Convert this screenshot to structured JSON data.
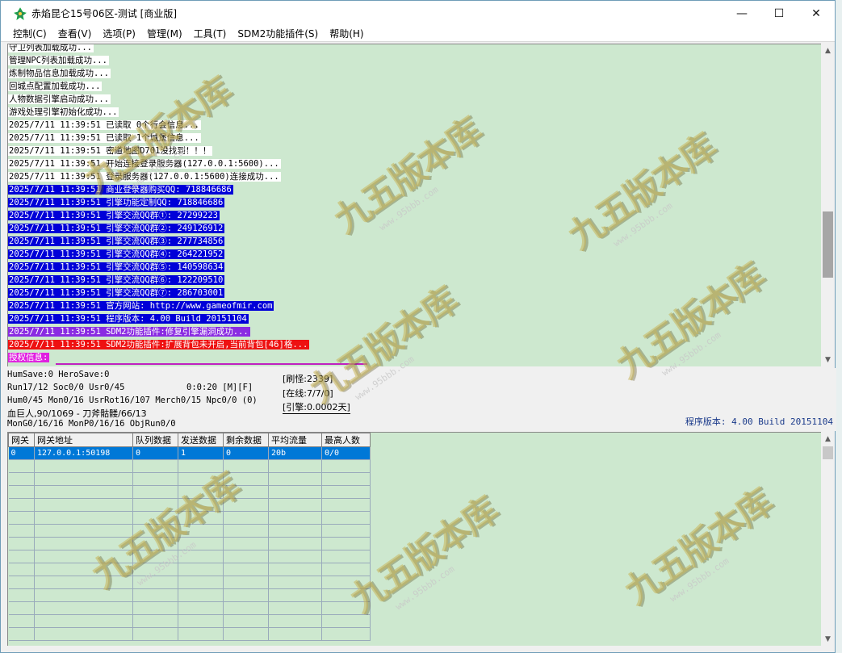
{
  "window": {
    "title": "赤焰昆仑15号06区-测试 [商业版]",
    "minimize": "—",
    "maximize": "☐",
    "close": "✕"
  },
  "menu": [
    "控制(C)",
    "查看(V)",
    "选项(P)",
    "管理(M)",
    "工具(T)",
    "SDM2功能插件(S)",
    "帮助(H)"
  ],
  "log": [
    {
      "text": "守卫列表加载成功...",
      "style": "white"
    },
    {
      "text": "管理NPC列表加载成功...",
      "style": "white"
    },
    {
      "text": "炼制物品信息加载成功...",
      "style": "white"
    },
    {
      "text": "回城点配置加载成功...",
      "style": "white"
    },
    {
      "text": "人物数据引擎启动成功...",
      "style": "white"
    },
    {
      "text": "游戏处理引擎初始化成功...",
      "style": "white"
    },
    {
      "text": "2025/7/11 11:39:51 已读取 0个行会信息...",
      "style": "white"
    },
    {
      "text": "2025/7/11 11:39:51 已读取 1个城堡信息...",
      "style": "white"
    },
    {
      "text": "2025/7/11 11:39:51 密道地图D701没找到！！！",
      "style": "white"
    },
    {
      "text": "2025/7/11 11:39:51 开始连接登录服务器(127.0.0.1:5600)...",
      "style": "white"
    },
    {
      "text": "2025/7/11 11:39:51 登录服务器(127.0.0.1:5600)连接成功...",
      "style": "white"
    },
    {
      "text": "2025/7/11 11:39:51 商业登录器购买QQ: 718846686",
      "style": "blue"
    },
    {
      "text": "2025/7/11 11:39:51 引擎功能定制QQ: 718846686",
      "style": "blue"
    },
    {
      "text": "2025/7/11 11:39:51 引擎交流QQ群①: 27299223",
      "style": "blue"
    },
    {
      "text": "2025/7/11 11:39:51 引擎交流QQ群②: 249126912",
      "style": "blue"
    },
    {
      "text": "2025/7/11 11:39:51 引擎交流QQ群③: 277734856",
      "style": "blue"
    },
    {
      "text": "2025/7/11 11:39:51 引擎交流QQ群④: 264221952",
      "style": "blue"
    },
    {
      "text": "2025/7/11 11:39:51 引擎交流QQ群⑤: 140598634",
      "style": "blue"
    },
    {
      "text": "2025/7/11 11:39:51 引擎交流QQ群⑥: 122209510",
      "style": "blue"
    },
    {
      "text": "2025/7/11 11:39:51 引擎交流QQ群⑦: 286703001",
      "style": "blue"
    },
    {
      "text": "2025/7/11 11:39:51 官方网站: http://www.gameofmir.com",
      "style": "blue"
    },
    {
      "text": "2025/7/11 11:39:51 程序版本: 4.00 Build 20151104",
      "style": "blue"
    },
    {
      "text": "2025/7/11 11:39:51 SDM2功能插件:修复引擎漏洞成功...",
      "style": "purple"
    },
    {
      "text": "2025/7/11 11:39:51 SDM2功能插件:扩展背包未开启,当前背包[46]格...",
      "style": "red"
    },
    {
      "text": "授权信息:",
      "style": "magenta"
    }
  ],
  "status": {
    "line1": "HumSave:0 HeroSave:0",
    "line2": "Run17/12 Soc0/0 Usr0/45",
    "line2_time": "0:0:20 [M][F]",
    "line3": "Hum0/45 Mon0/16 UsrRot16/107 Merch0/15 Npc0/0 (0)",
    "line4": "血巨人,90/1069 - 刀斧骷髅/66/13",
    "line5": "MonG0/16/16 MonP0/16/16 ObjRun0/0",
    "refresh": "[刷怪:2339]",
    "online": "[在线:7/7/0]",
    "engine": "[引擎:0.0002天]",
    "version": "程序版本: 4.00 Build 20151104"
  },
  "gateway_table": {
    "headers": [
      "网关",
      "网关地址",
      "队列数据",
      "发送数据",
      "剩余数据",
      "平均流量",
      "最高人数"
    ],
    "rows": [
      [
        "0",
        "127.0.0.1:50198",
        "0",
        "1",
        "0",
        "20b",
        "0/0"
      ]
    ]
  },
  "watermark": {
    "text": "九五版本库",
    "url": "www.95bbb.com"
  },
  "colors": {
    "log_bg": "#cde8cf",
    "blue": "#0000d8",
    "purple": "#8a2be2",
    "red": "#ee1111",
    "magenta": "#e020e0",
    "selected": "#0078d7"
  }
}
